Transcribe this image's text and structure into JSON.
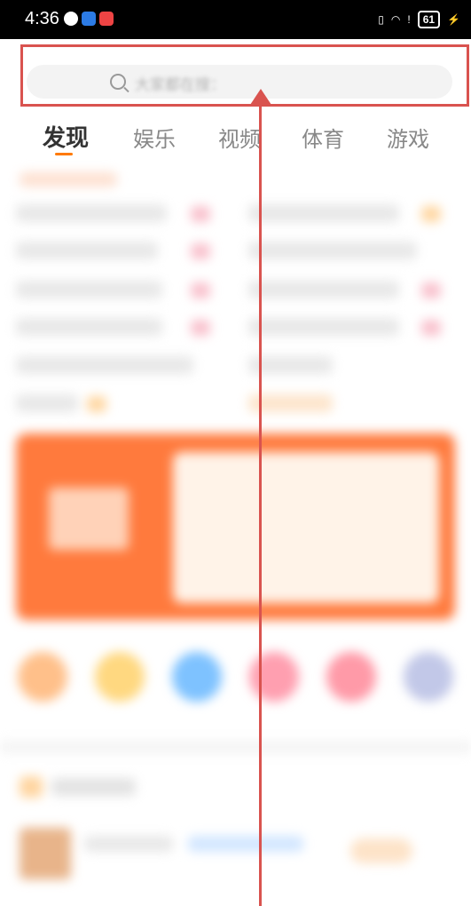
{
  "status_bar": {
    "time": "4:36",
    "battery": "61"
  },
  "search": {
    "placeholder": "大家都在搜："
  },
  "tabs": [
    {
      "label": "发现",
      "active": true
    },
    {
      "label": "娱乐"
    },
    {
      "label": "视频"
    },
    {
      "label": "体育"
    },
    {
      "label": "游戏"
    }
  ],
  "colors": {
    "accent": "#ff7a00",
    "annotation": "#d9534f",
    "search_bg": "#f3f3f3"
  }
}
